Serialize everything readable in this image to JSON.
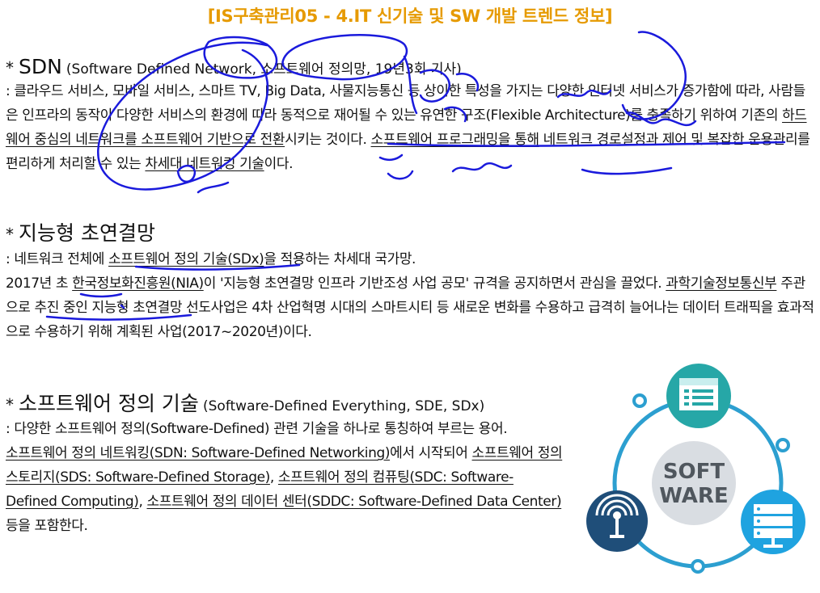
{
  "title": "[IS구축관리05 - 4.IT 신기술 및 SW 개발 트렌드 정보]",
  "sections": {
    "sdn": {
      "bullet": "*",
      "heading": "SDN",
      "subheading": "(Software Defined Network, 소프트웨어 정의망, 19년3회 기사)",
      "body": {
        "p1": ": 클라우드 서비스, 모바일 서비스, 스마트 TV, Big Data, 사물지능통신 등 상이한 특성을 가지는 다양한 인터넷 서비스가 증가함에 따라, 사람들은 인프라의 동작이 다양한 서비스의 환경에 따라 동적으로 재어될 수 있는 유연한 구조(Flexible Architecture)를 충족하기 위하여 기존의 ",
        "u1": "하드웨어 중심의 네트워크를 소프트웨어 기반으로 전환",
        "p2": "시키는 것이다. ",
        "u2": "소프트웨어 프로그래밍을 통해",
        "p3": " 네트워크 경로설정과 제어 및 복잡한 운용관리를 편리하게 처리할 수 있는 ",
        "u3": "차세대 네트워킹 기술",
        "p4": "이다."
      }
    },
    "smart_network": {
      "bullet": "*",
      "heading": "지능형 초연결망",
      "body": {
        "p1": ": 네트워크 전체에 ",
        "u1": "소프트웨어 정의 기술(SDx)",
        "p2": "을 적용하는 차세대 국가망.",
        "p3": "2017년 초 ",
        "u2": "한국정보화진흥원(NIA)",
        "p4": "이 '지능형 초연결망 인프라 기반조성 사업 공모' 규격을 공지하면서 관심을 끌었다. ",
        "u3": "과학기술정보통신부",
        "p5": " 주관으로 추진 중인 지능형 초연결망 선도사업은 4차 산업혁명 시대의 스마트시티 등 새로운 변화를 수용하고 급격히 늘어나는 데이터 트래픽을 효과적으로 수용하기 위해 계획된 사업(2017~2020년)이다."
      }
    },
    "sde": {
      "bullet": "*",
      "heading": "소프트웨어 정의 기술",
      "subheading": "(Software-Defined Everything, SDE, SDx)",
      "body": {
        "p1": ": 다양한 소프트웨어 정의(Software-Defined) 관련 기술을 하나로 통칭하여 부르는 용어.",
        "u1": "소프트웨어 정의 네트워킹(SDN: Software-Defined Networking)",
        "p2": "에서 시작되어 ",
        "u2": "소프트웨어 정의 스토리지(SDS: Software-Defined Storage)",
        "p3": ", ",
        "u3": "소프트웨어 정의 컴퓨팅(SDC: Software-Defined Computing)",
        "p4": ", ",
        "u4": "소프트웨어 정의 데이터 센터(SDDC: Software-Defined Data Center)",
        "p5": " 등을 포함한다."
      }
    }
  },
  "graphic": {
    "center_line1": "SOFT",
    "center_line2": "WARE",
    "icons": [
      "document-list-icon",
      "wifi-antenna-icon",
      "server-stack-icon"
    ],
    "colors": {
      "teal": "#26a7a7",
      "navy": "#1f4e79",
      "sky": "#1fa3e0",
      "ring": "#2c9fd0",
      "center": "#d9dde2"
    }
  },
  "colors": {
    "title": "#e69a00",
    "ink": "#1a1adc"
  }
}
